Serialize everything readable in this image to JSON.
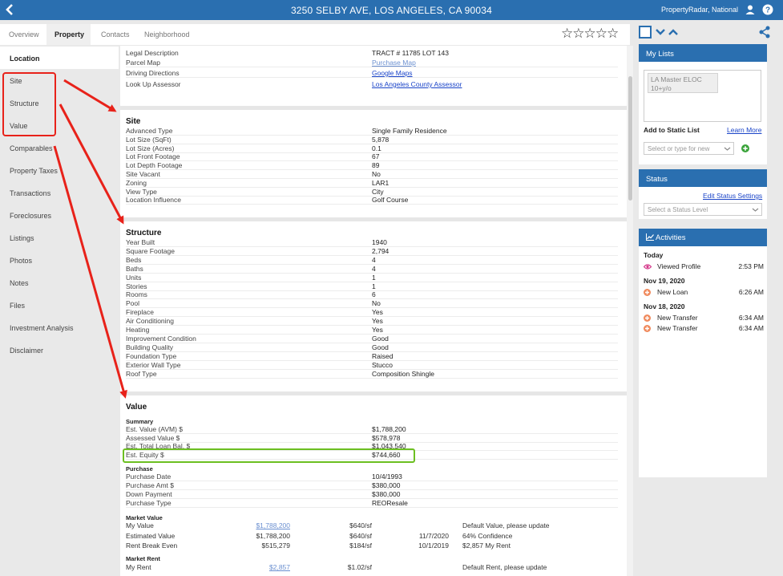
{
  "header": {
    "title": "3250 SELBY AVE, LOS ANGELES, CA 90034",
    "user": "PropertyRadar, National"
  },
  "tabs": [
    {
      "label": "Overview",
      "active": false
    },
    {
      "label": "Property",
      "active": true
    },
    {
      "label": "Contacts",
      "active": false
    },
    {
      "label": "Neighborhood",
      "active": false
    }
  ],
  "rating": {
    "stars": "☆☆☆☆☆"
  },
  "leftnav": {
    "items": [
      "Location",
      "Site",
      "Structure",
      "Value",
      "Comparables",
      "Property Taxes",
      "Transactions",
      "Foreclosures",
      "Listings",
      "Photos",
      "Notes",
      "Files",
      "Investment Analysis",
      "Disclaimer"
    ],
    "active": "Location"
  },
  "location": {
    "rows": [
      {
        "label": "Legal Description",
        "value": "TRACT # 11785 LOT 143"
      },
      {
        "label": "Parcel Map",
        "value": "Purchase Map"
      },
      {
        "label": "Driving Directions",
        "value": "Google Maps"
      },
      {
        "label": "Look Up Assessor",
        "value": "Los Angeles County Assessor"
      }
    ]
  },
  "site": {
    "title": "Site",
    "rows": [
      {
        "label": "Advanced Type",
        "value": "Single Family Residence"
      },
      {
        "label": "Lot Size (SqFt)",
        "value": "5,878"
      },
      {
        "label": "Lot Size (Acres)",
        "value": "0.1"
      },
      {
        "label": "Lot Front Footage",
        "value": "67"
      },
      {
        "label": "Lot Depth Footage",
        "value": "89"
      },
      {
        "label": "Site Vacant",
        "value": "No"
      },
      {
        "label": "Zoning",
        "value": "LAR1"
      },
      {
        "label": "View Type",
        "value": "City"
      },
      {
        "label": "Location Influence",
        "value": "Golf Course"
      }
    ]
  },
  "structure": {
    "title": "Structure",
    "rows": [
      {
        "label": "Year Built",
        "value": "1940"
      },
      {
        "label": "Square Footage",
        "value": "2,794"
      },
      {
        "label": "Beds",
        "value": "4"
      },
      {
        "label": "Baths",
        "value": "4"
      },
      {
        "label": "Units",
        "value": "1"
      },
      {
        "label": "Stories",
        "value": "1"
      },
      {
        "label": "Rooms",
        "value": "6"
      },
      {
        "label": "Pool",
        "value": "No"
      },
      {
        "label": "Fireplace",
        "value": "Yes"
      },
      {
        "label": "Air Conditioning",
        "value": "Yes"
      },
      {
        "label": "Heating",
        "value": "Yes"
      },
      {
        "label": "Improvement Condition",
        "value": "Good"
      },
      {
        "label": "Building Quality",
        "value": "Good"
      },
      {
        "label": "Foundation Type",
        "value": "Raised"
      },
      {
        "label": "Exterior Wall Type",
        "value": "Stucco"
      },
      {
        "label": "Roof Type",
        "value": "Composition Shingle"
      }
    ]
  },
  "value": {
    "title": "Value",
    "summary_title": "Summary",
    "summary": [
      {
        "label": "Est. Value (AVM) $",
        "value": "$1,788,200"
      },
      {
        "label": "Assessed Value $",
        "value": "$578,978"
      },
      {
        "label": "Est. Total Loan Bal. $",
        "value": "$1,043,540"
      },
      {
        "label": "Est. Equity $",
        "value": "$744,660"
      }
    ],
    "purchase_title": "Purchase",
    "purchase": [
      {
        "label": "Purchase Date",
        "value": "10/4/1993"
      },
      {
        "label": "Purchase Amt $",
        "value": "$380,000"
      },
      {
        "label": "Down Payment",
        "value": "$380,000"
      },
      {
        "label": "Purchase Type",
        "value": "REOResale"
      }
    ],
    "market_value_title": "Market Value",
    "market_value": [
      {
        "label": "My Value",
        "amount": "$1,788,200",
        "per_sf": "$640/sf",
        "date": "",
        "note": "Default Value, please update"
      },
      {
        "label": "Estimated Value",
        "amount": "$1,788,200",
        "per_sf": "$640/sf",
        "date": "11/7/2020",
        "note": "64% Confidence"
      },
      {
        "label": "Rent Break Even",
        "amount": "$515,279",
        "per_sf": "$184/sf",
        "date": "10/1/2019",
        "note": "$2,857 My Rent"
      }
    ],
    "market_rent_title": "Market Rent",
    "market_rent": [
      {
        "label": "My Rent",
        "amount": "$2,857",
        "per_sf": "$1.02/sf",
        "date": "",
        "note": "Default Rent, please update"
      }
    ]
  },
  "sidebar": {
    "my_lists": {
      "title": "My Lists",
      "chip_line1": "LA Master ELOC",
      "chip_line2": "10+y/o",
      "add_label": "Add to Static List",
      "learn_more": "Learn More",
      "select_placeholder": "Select or type for new"
    },
    "status": {
      "title": "Status",
      "edit_link": "Edit Status Settings",
      "select_placeholder": "Select a Status Level"
    },
    "activities": {
      "title": "Activities",
      "groups": [
        {
          "date": "Today",
          "items": [
            {
              "label": "Viewed Profile",
              "time": "2:53 PM",
              "icon": "eye-icon"
            }
          ]
        },
        {
          "date": "Nov 19, 2020",
          "items": [
            {
              "label": "New Loan",
              "time": "6:26 AM",
              "icon": "plus-circle-icon"
            }
          ]
        },
        {
          "date": "Nov 18, 2020",
          "items": [
            {
              "label": "New Transfer",
              "time": "6:34 AM",
              "icon": "plus-circle-icon"
            },
            {
              "label": "New Transfer",
              "time": "6:34 AM",
              "icon": "plus-circle-icon"
            }
          ]
        }
      ]
    }
  },
  "colors": {
    "brand_blue": "#2a6fb0",
    "annotation_red": "#e8221a",
    "highlight_green": "#6cbf21",
    "activity_view": "#d4388a",
    "activity_add": "#f08a5d",
    "add_green": "#3aa33a"
  }
}
